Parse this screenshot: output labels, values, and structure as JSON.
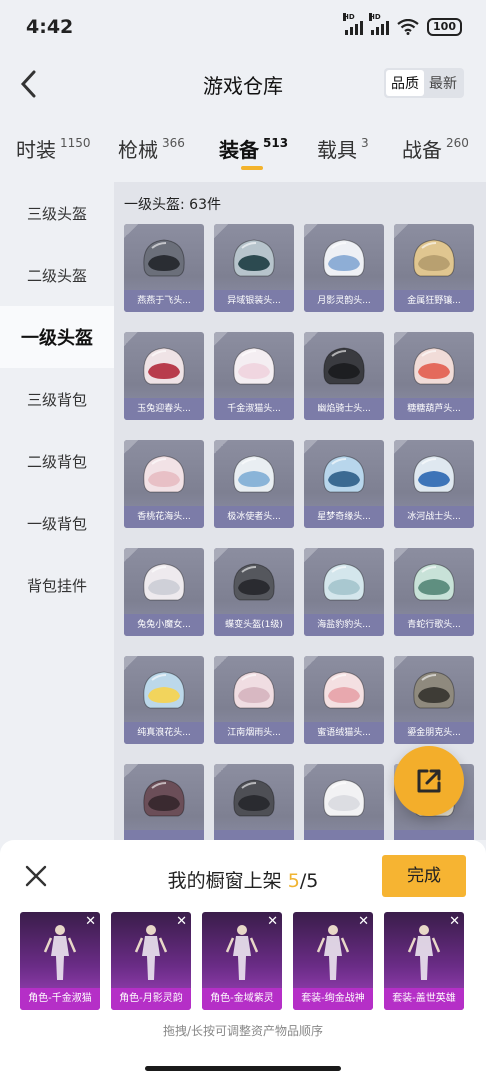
{
  "status_bar": {
    "time": "4:42",
    "battery": "100",
    "network_badge": "HD"
  },
  "header": {
    "title": "游戏仓库",
    "sort_options": [
      "品质",
      "最新"
    ],
    "sort_selected": "品质"
  },
  "tabs": [
    {
      "label": "时装",
      "count": "1150"
    },
    {
      "label": "枪械",
      "count": "366"
    },
    {
      "label": "装备",
      "count": "513",
      "active": true
    },
    {
      "label": "载具",
      "count": "3"
    },
    {
      "label": "战备",
      "count": "260"
    }
  ],
  "sidebar": {
    "items": [
      {
        "label": "三级头盔"
      },
      {
        "label": "二级头盔"
      },
      {
        "label": "一级头盔",
        "active": true
      },
      {
        "label": "三级背包"
      },
      {
        "label": "二级背包"
      },
      {
        "label": "一级背包"
      },
      {
        "label": "背包挂件"
      }
    ]
  },
  "content": {
    "section_title": "一级头盔: 63件",
    "items": [
      {
        "label": "燕燕于飞头...",
        "color": "#6b6f7a",
        "visor": "#2a2d33"
      },
      {
        "label": "异域银装头...",
        "color": "#b7c4cc",
        "visor": "#2c4a50"
      },
      {
        "label": "月影灵韵头...",
        "color": "#eef0f5",
        "visor": "#8eaed6"
      },
      {
        "label": "金属狂野镶...",
        "color": "#e0c690",
        "visor": "#b8a070"
      },
      {
        "label": "玉兔迎春头...",
        "color": "#efe3e6",
        "visor": "#b83c4c"
      },
      {
        "label": "千金淑猫头...",
        "color": "#f4eef2",
        "visor": "#f0d6e0"
      },
      {
        "label": "幽焰骑士头...",
        "color": "#3a3b40",
        "visor": "#1d1e21"
      },
      {
        "label": "糖糖葫芦头...",
        "color": "#f1dcd8",
        "visor": "#e46a5c"
      },
      {
        "label": "香桃花海头...",
        "color": "#f2e2e6",
        "visor": "#e8c0c6"
      },
      {
        "label": "极冰使者头...",
        "color": "#e9eef2",
        "visor": "#8ab4d8"
      },
      {
        "label": "星梦奇缘头...",
        "color": "#b8d6ec",
        "visor": "#3b6a92"
      },
      {
        "label": "冰河战士头...",
        "color": "#dfe8f0",
        "visor": "#3d74b8"
      },
      {
        "label": "兔兔小魔女...",
        "color": "#eeeaee",
        "visor": "#cfd0d8"
      },
      {
        "label": "蝶变头盔(1级)",
        "color": "#55575d",
        "visor": "#2a2b30"
      },
      {
        "label": "海盐豹豹头...",
        "color": "#d4e6ec",
        "visor": "#a9c8d0"
      },
      {
        "label": "青蛇行歌头...",
        "color": "#c8e2d8",
        "visor": "#5f8f80"
      },
      {
        "label": "纯真浪花头...",
        "color": "#bcd8ea",
        "visor": "#f2d45c"
      },
      {
        "label": "江南烟雨头...",
        "color": "#f0dde2",
        "visor": "#d8b8c2"
      },
      {
        "label": "蜜语绒猫头...",
        "color": "#f4e0e2",
        "visor": "#e8a8ae"
      },
      {
        "label": "鎏金朋克头...",
        "color": "#8f8a7e",
        "visor": "#3e3c36"
      },
      {
        "label": "",
        "color": "#6b4e58",
        "visor": "#3a2a30"
      },
      {
        "label": "",
        "color": "#4e4f55",
        "visor": "#2a2b30"
      },
      {
        "label": "",
        "color": "#f2f2f4",
        "visor": "#dcdde2"
      },
      {
        "label": "",
        "color": "#e6e0d0",
        "visor": "#b8ae96"
      }
    ]
  },
  "fab": {
    "icon": "share-export-icon"
  },
  "showcase": {
    "title_prefix": "我的橱窗上架",
    "current": "5",
    "total": "/5",
    "done_label": "完成",
    "items": [
      {
        "label": "角色-千金淑猫"
      },
      {
        "label": "角色-月影灵韵"
      },
      {
        "label": "角色-金域紫灵"
      },
      {
        "label": "套装-绚金战神"
      },
      {
        "label": "套装-盖世英雄"
      }
    ],
    "hint": "拖拽/长按可调整资产物品顺序"
  },
  "colors": {
    "accent": "#f3b32c",
    "card_label": "#7c7ca8",
    "showcase_label": "#b52fc7"
  }
}
